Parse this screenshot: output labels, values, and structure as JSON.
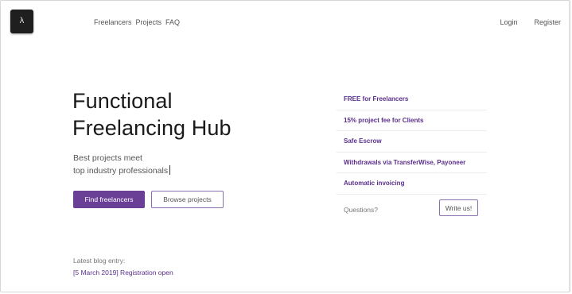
{
  "logo": {
    "glyph": "λ"
  },
  "nav": {
    "items": [
      "Freelancers",
      "Projects",
      "FAQ"
    ]
  },
  "auth": {
    "login": "Login",
    "register": "Register"
  },
  "hero": {
    "title_line1": "Functional",
    "title_line2": "Freelancing Hub",
    "subtitle_line1": "Best projects meet",
    "subtitle_line2": "top industry professionals",
    "primary_button": "Find freelancers",
    "secondary_button": "Browse projects"
  },
  "blog": {
    "label": "Latest blog entry:",
    "link": "[5 March 2019] Registration open"
  },
  "features": {
    "items": [
      "FREE for Freelancers",
      "15% project fee for Clients",
      "Safe Escrow",
      "Withdrawals via TransferWise, Payoneer",
      "Automatic invoicing"
    ],
    "questions_label": "Questions?",
    "contact_button": "Write us!"
  },
  "colors": {
    "accent": "#6a3f96",
    "link": "#5a2f8c",
    "logo_bg": "#1f1f1f"
  }
}
